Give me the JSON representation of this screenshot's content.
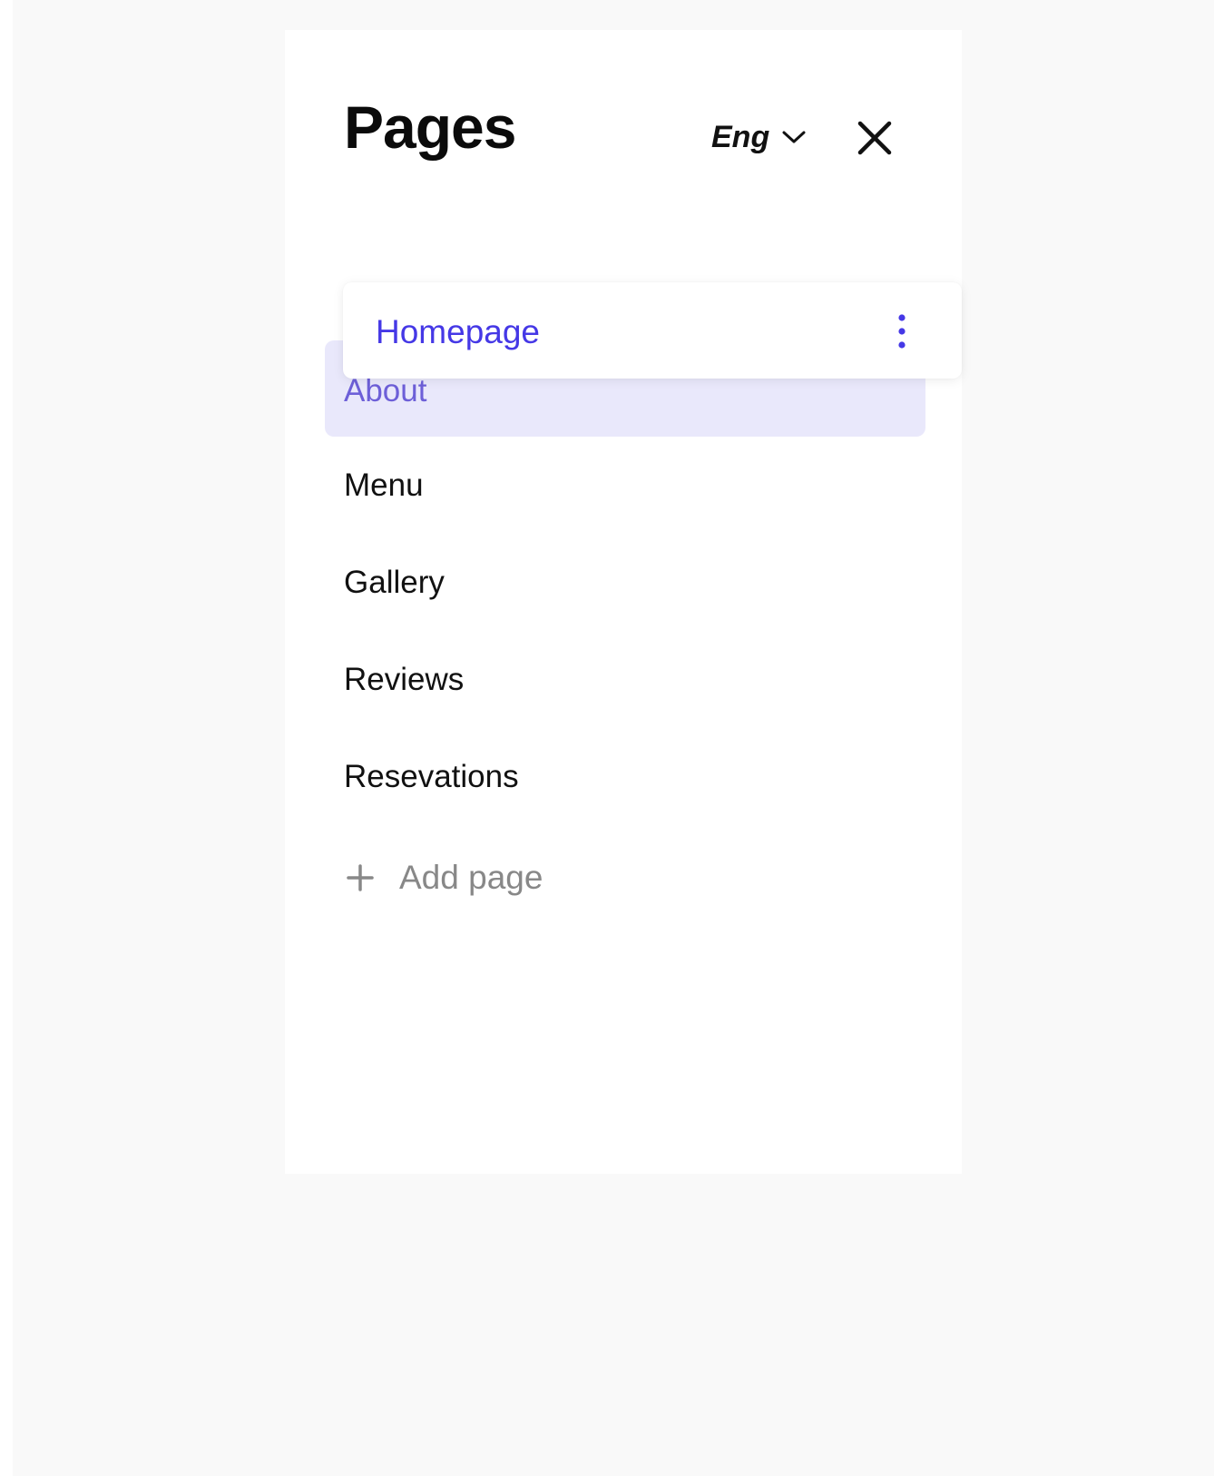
{
  "panel": {
    "title": "Pages",
    "language": "Eng"
  },
  "pages": {
    "dragging": "Homepage",
    "selected": "About",
    "items": [
      "Menu",
      "Gallery",
      "Reviews",
      "Resevations"
    ]
  },
  "add_page": {
    "label": "Add page"
  },
  "colors": {
    "accent": "#4538e6",
    "selected_bg": "#e9e8fb",
    "selected_text": "#6d5fd8",
    "muted": "#888888"
  },
  "icons": {
    "language": "chevron-down-icon",
    "close": "close-icon",
    "more": "more-vertical-icon",
    "add": "plus-icon"
  }
}
